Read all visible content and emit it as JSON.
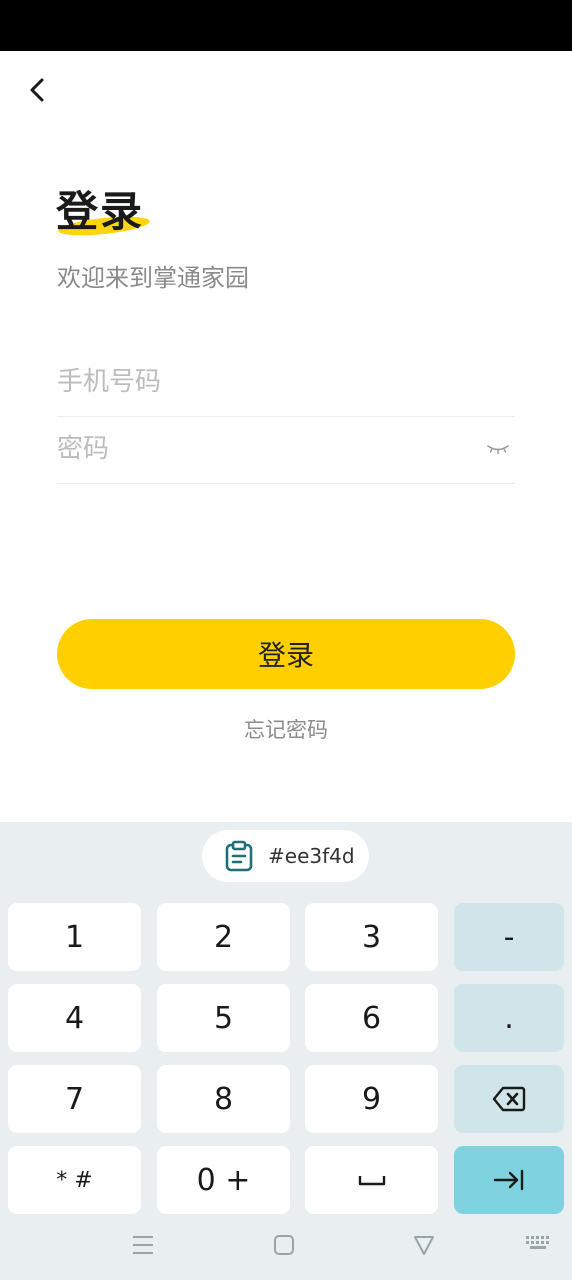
{
  "header": {
    "back_icon": "chevron-left-icon"
  },
  "login": {
    "title": "登录",
    "subtitle": "欢迎来到掌通家园",
    "phone_placeholder": "手机号码",
    "password_placeholder": "密码",
    "password_toggle_icon": "eye-closed-icon",
    "submit_label": "登录",
    "forgot_label": "忘记密码"
  },
  "colors": {
    "accent": "#ffcf00",
    "keyboard_bg": "#e9eff1",
    "function_key": "#d0e5ea",
    "enter_key": "#7fd3e0"
  },
  "keyboard": {
    "clipboard": {
      "icon": "clipboard-icon",
      "text": "#ee3f4d"
    },
    "rows": [
      [
        "1",
        "2",
        "3",
        "-"
      ],
      [
        "4",
        "5",
        "6",
        "."
      ],
      [
        "7",
        "8",
        "9",
        "backspace-icon"
      ],
      [
        "* #",
        "0 +",
        "space-icon",
        "tab-enter-icon"
      ]
    ],
    "keys": {
      "k1": "1",
      "k2": "2",
      "k3": "3",
      "minus": "-",
      "k4": "4",
      "k5": "5",
      "k6": "6",
      "dot": ".",
      "k7": "7",
      "k8": "8",
      "k9": "9",
      "symbols": "* #",
      "zero_plus": "0 +"
    }
  },
  "navbar": {
    "icons": [
      "menu-icon",
      "home-square-icon",
      "back-triangle-icon",
      "keyboard-icon"
    ]
  }
}
